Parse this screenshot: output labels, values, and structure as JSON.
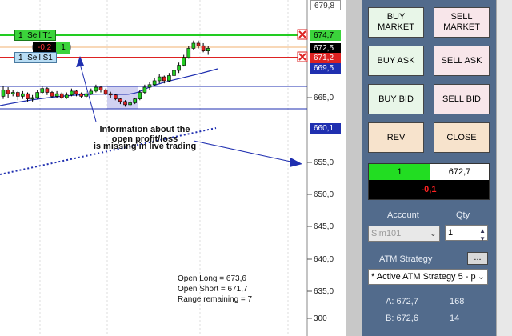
{
  "chart": {
    "price_labels": [
      "679,8",
      "665,0",
      "660,1",
      "655,0",
      "650,0",
      "645,0",
      "640,0",
      "635,0",
      "300"
    ],
    "tag_sell_t1": {
      "qty": "1",
      "label": "Sell T1"
    },
    "tag_sell_s1": {
      "qty": "1",
      "label": "Sell S1"
    },
    "tag_pl": {
      "value": "-0,2",
      "qty": "1"
    },
    "axis_boxes": {
      "green": "674,7",
      "black": "672,5",
      "red": "671,2",
      "blue": "669,5",
      "blue2": "660,1"
    },
    "annotation": [
      "Information about the",
      "open profit/loss",
      "is missing in live trading"
    ],
    "stats": [
      "Open Long = 673,6",
      "Open Short = 671,7",
      "Range remaining = 7"
    ],
    "candles": [
      {
        "o": 665.2,
        "c": 666.2,
        "h": 666.8,
        "l": 664.8
      },
      {
        "o": 666.2,
        "c": 665.6,
        "h": 666.6,
        "l": 665.0
      },
      {
        "o": 665.6,
        "c": 665.8,
        "h": 666.2,
        "l": 665.2
      },
      {
        "o": 665.8,
        "c": 665.2,
        "h": 666.0,
        "l": 664.6
      },
      {
        "o": 665.2,
        "c": 665.6,
        "h": 666.0,
        "l": 664.8
      },
      {
        "o": 665.6,
        "c": 664.8,
        "h": 665.8,
        "l": 664.4
      },
      {
        "o": 664.8,
        "c": 665.0,
        "h": 665.4,
        "l": 664.4
      },
      {
        "o": 665.0,
        "c": 665.8,
        "h": 666.2,
        "l": 664.8
      },
      {
        "o": 665.8,
        "c": 666.4,
        "h": 666.8,
        "l": 665.6
      },
      {
        "o": 666.4,
        "c": 665.8,
        "h": 666.6,
        "l": 665.4
      },
      {
        "o": 665.8,
        "c": 665.2,
        "h": 666.0,
        "l": 665.0
      },
      {
        "o": 665.2,
        "c": 665.6,
        "h": 666.0,
        "l": 664.9
      },
      {
        "o": 665.6,
        "c": 665.0,
        "h": 665.8,
        "l": 664.8
      },
      {
        "o": 665.0,
        "c": 665.4,
        "h": 665.8,
        "l": 664.8
      },
      {
        "o": 665.4,
        "c": 666.0,
        "h": 666.4,
        "l": 665.2
      },
      {
        "o": 666.0,
        "c": 665.6,
        "h": 666.2,
        "l": 665.2
      },
      {
        "o": 665.6,
        "c": 665.2,
        "h": 665.8,
        "l": 665.0
      },
      {
        "o": 665.2,
        "c": 665.6,
        "h": 666.0,
        "l": 665.0
      },
      {
        "o": 665.6,
        "c": 666.0,
        "h": 666.4,
        "l": 665.4
      },
      {
        "o": 666.0,
        "c": 666.6,
        "h": 667.0,
        "l": 665.8
      },
      {
        "o": 666.6,
        "c": 666.2,
        "h": 666.8,
        "l": 665.8
      },
      {
        "o": 666.2,
        "c": 665.6,
        "h": 666.4,
        "l": 665.4
      },
      {
        "o": 665.6,
        "c": 665.4,
        "h": 665.9,
        "l": 665.0
      },
      {
        "o": 665.4,
        "c": 664.8,
        "h": 665.6,
        "l": 664.6
      },
      {
        "o": 664.8,
        "c": 664.4,
        "h": 665.0,
        "l": 664.0
      },
      {
        "o": 664.4,
        "c": 663.9,
        "h": 664.6,
        "l": 663.6
      },
      {
        "o": 663.9,
        "c": 664.2,
        "h": 664.6,
        "l": 663.6
      },
      {
        "o": 664.2,
        "c": 664.8,
        "h": 665.0,
        "l": 664.0
      },
      {
        "o": 664.8,
        "c": 665.8,
        "h": 666.2,
        "l": 664.6
      },
      {
        "o": 665.8,
        "c": 666.6,
        "h": 667.0,
        "l": 665.6
      },
      {
        "o": 666.6,
        "c": 667.0,
        "h": 667.4,
        "l": 666.2
      },
      {
        "o": 667.0,
        "c": 667.6,
        "h": 668.0,
        "l": 666.8
      },
      {
        "o": 667.6,
        "c": 668.2,
        "h": 668.6,
        "l": 667.2
      },
      {
        "o": 668.2,
        "c": 667.6,
        "h": 668.4,
        "l": 667.2
      },
      {
        "o": 667.6,
        "c": 668.4,
        "h": 668.8,
        "l": 667.4
      },
      {
        "o": 668.4,
        "c": 669.2,
        "h": 669.6,
        "l": 668.0
      },
      {
        "o": 669.2,
        "c": 670.0,
        "h": 670.4,
        "l": 668.8
      },
      {
        "o": 670.0,
        "c": 671.2,
        "h": 671.6,
        "l": 669.8
      },
      {
        "o": 671.2,
        "c": 672.6,
        "h": 673.0,
        "l": 671.0
      },
      {
        "o": 672.6,
        "c": 673.4,
        "h": 673.8,
        "l": 672.4
      },
      {
        "o": 673.4,
        "c": 673.0,
        "h": 673.8,
        "l": 672.6
      },
      {
        "o": 673.0,
        "c": 672.2,
        "h": 673.4,
        "l": 672.0
      },
      {
        "o": 672.2,
        "c": 672.6,
        "h": 672.9,
        "l": 671.6
      }
    ]
  },
  "panel": {
    "buy_market": "BUY\nMARKET",
    "sell_market": "SELL\nMARKET",
    "buy_ask": "BUY ASK",
    "sell_ask": "SELL ASK",
    "buy_bid": "BUY BID",
    "sell_bid": "SELL BID",
    "rev": "REV",
    "close": "CLOSE",
    "position_qty": "1",
    "position_price": "672,7",
    "pnl": "-0,1",
    "account_label": "Account",
    "qty_label": "Qty",
    "account_value": "Sim101",
    "qty_value": "1",
    "atm_label": "ATM Strategy",
    "atm_button": "...",
    "atm_value": "* Active ATM Strategy 5 - p",
    "ask_label": "A: 672,7",
    "ask_size": "168",
    "bid_label": "B: 672,6",
    "bid_size": "14"
  },
  "colors": {
    "panel": "#526b8c",
    "green": "#22cc22",
    "red": "#dd2222",
    "blue": "#1f2fb0"
  }
}
